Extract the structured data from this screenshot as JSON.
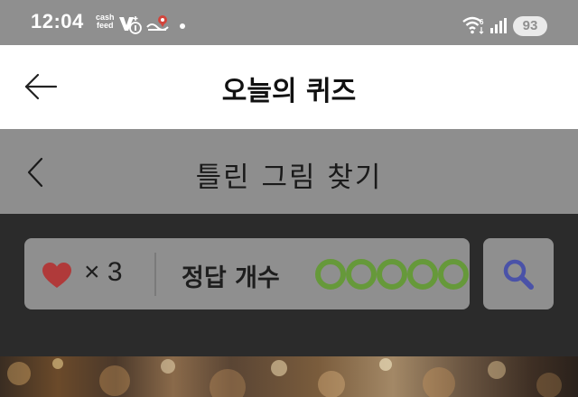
{
  "status_bar": {
    "time": "12:04",
    "cashfeed_line1": "cash",
    "cashfeed_line2": "feed",
    "battery": "93",
    "icons": [
      "cashfeed-icon",
      "v-badge-icon",
      "delivery-pin-icon",
      "notification-dot",
      "wifi-icon",
      "signal-icon",
      "battery-badge"
    ]
  },
  "header": {
    "title": "오늘의 퀴즈",
    "back_icon": "arrow-left-icon"
  },
  "sub_header": {
    "title": "틀린 그림 찾기",
    "back_icon": "chevron-left-icon"
  },
  "game": {
    "lives_icon": "heart-icon",
    "lives_text": "× 3",
    "lives_count": 3,
    "answer_label": "정답 개수",
    "answer_slots": 5,
    "answers_found": 0,
    "hint_icon": "search-icon"
  },
  "colors": {
    "status_bar_bg": "#8f8f8f",
    "header_bg": "#ffffff",
    "sub_header_bg": "#8e8e8e",
    "game_bg": "#2b2b2b",
    "panel_bg": "#8f8f8f",
    "heart": "#b03a3a",
    "answer_circle": "#66993a",
    "search_icon": "#4a52a8"
  }
}
